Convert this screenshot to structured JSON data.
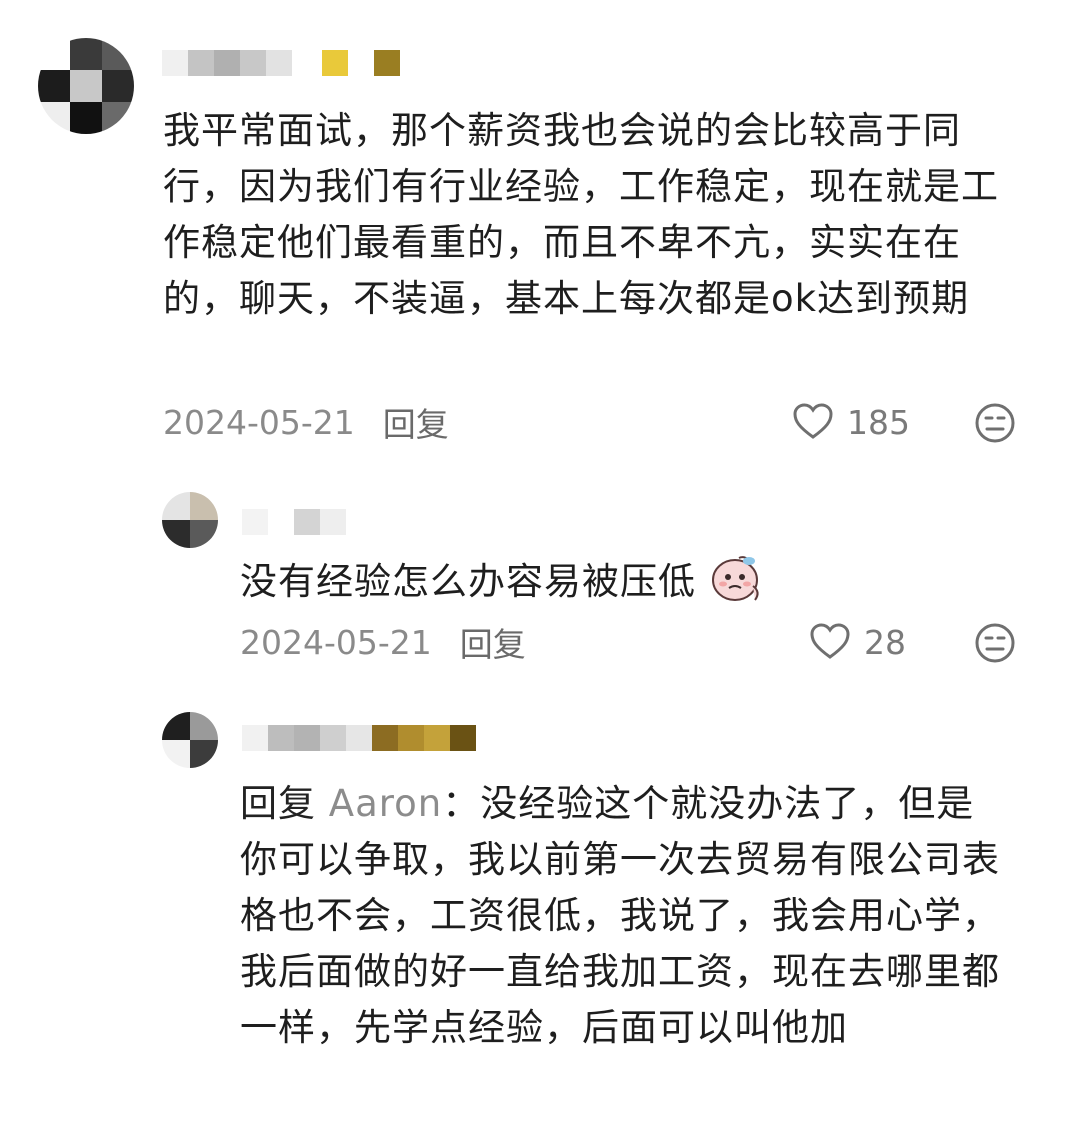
{
  "comments": [
    {
      "text": "我平常面试，那个薪资我也会说的会比较高于同行，因为我们有行业经验，工作稳定，现在就是工作稳定他们最看重的，而且不卑不亢，实实在在的，聊天，不装逼，基本上每次都是ok达到预期",
      "date": "2024-05-21",
      "reply_label": "回复",
      "likes": "185",
      "icons": {
        "like": "heart-outline-icon",
        "dislike": "meh-face-icon"
      }
    },
    {
      "text": "没有经验怎么办容易被压低",
      "emoji": "crying-face-sticker",
      "date": "2024-05-21",
      "reply_label": "回复",
      "likes": "28",
      "icons": {
        "like": "heart-outline-icon",
        "dislike": "meh-face-icon"
      }
    },
    {
      "reply_prefix": "回复",
      "mention": "Aaron",
      "colon": "：",
      "text": "没经验这个就没办法了，但是你可以争取，我以前第一次去贸易有限公司表格也不会，工资很低，我说了，我会用心学，我后面做的好一直给我加工资，现在去哪里都一样，先学点经验，后面可以叫他加"
    }
  ],
  "colors": {
    "text": "#1e1e1e",
    "meta": "#8a8a8a",
    "mention": "#8c8c8c",
    "icon": "#6f6f6f"
  }
}
